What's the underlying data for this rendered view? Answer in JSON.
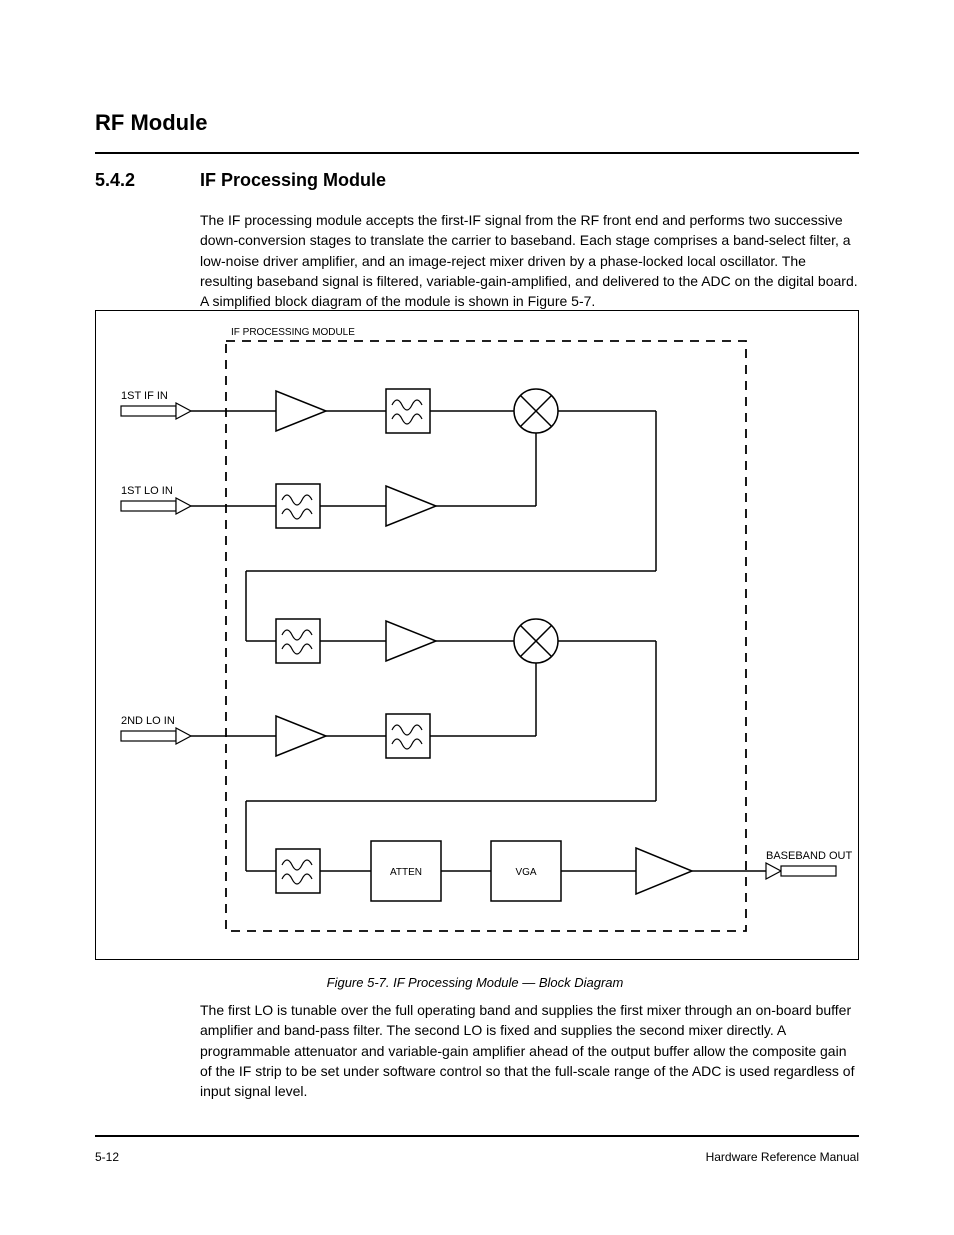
{
  "header": {
    "section_title": "RF Module",
    "section_num": "5.4.2",
    "section_name": "IF Processing Module"
  },
  "text": {
    "para1": "The IF processing module accepts the first-IF signal from the RF front end and performs two successive down-conversion stages to translate the carrier to baseband. Each stage comprises a band-select filter, a low-noise driver amplifier, and an image-reject mixer driven by a phase-locked local oscillator. The resulting baseband signal is filtered, variable-gain-amplified, and delivered to the ADC on the digital board. A simplified block diagram of the module is shown in Figure 5-7.",
    "para2": "The first LO is tunable over the full operating band and supplies the first mixer through an on-board buffer amplifier and band-pass filter. The second LO is fixed and supplies the second mixer directly. A programmable attenuator and variable-gain amplifier ahead of the output buffer allow the composite gain of the IF strip to be set under software control so that the full-scale range of the ADC is used regardless of input signal level.",
    "figure_caption": "Figure 5-7.  IF Processing Module — Block Diagram"
  },
  "diagram": {
    "inner_box_label": "IF PROCESSING MODULE",
    "ports": {
      "rf_in": {
        "label": "1ST IF IN"
      },
      "lo1_in": {
        "label": "1ST LO IN"
      },
      "lo2_in": {
        "label": "2ND LO IN"
      },
      "bb_out": {
        "label": "BASEBAND OUT"
      }
    },
    "blocks": {
      "amp1": {
        "label": ""
      },
      "bpf1": {
        "label": ""
      },
      "mix1": {
        "label": ""
      },
      "lo1flt": {
        "label": ""
      },
      "lo1amp": {
        "label": ""
      },
      "bpf2": {
        "label": ""
      },
      "amp2": {
        "label": ""
      },
      "mix2": {
        "label": ""
      },
      "lo2amp": {
        "label": ""
      },
      "lo2flt": {
        "label": ""
      },
      "bpf3": {
        "label": ""
      },
      "att": {
        "label": "ATTEN"
      },
      "vga": {
        "label": "VGA"
      },
      "buf": {
        "label": ""
      }
    }
  },
  "footer": {
    "left": "5-12",
    "right": "Hardware Reference Manual"
  }
}
